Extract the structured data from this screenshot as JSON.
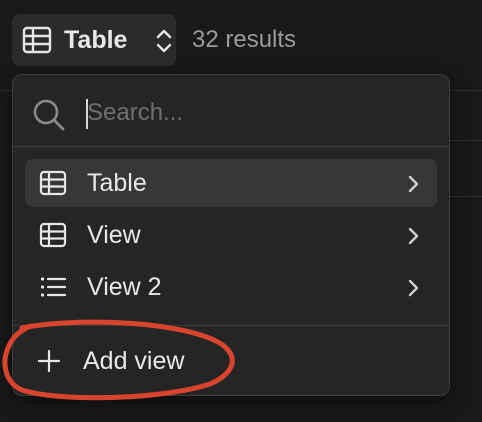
{
  "header": {
    "view_label": "Table",
    "view_icon": "table-icon",
    "chevron_icon": "chevron-up-down-icon",
    "results_text": "32 results"
  },
  "menu": {
    "search": {
      "placeholder": "Search...",
      "value": "",
      "icon": "search-icon"
    },
    "items": [
      {
        "label": "Table",
        "icon": "table-icon",
        "active": true
      },
      {
        "label": "View",
        "icon": "table-icon",
        "active": false
      },
      {
        "label": "View 2",
        "icon": "list-icon",
        "active": false
      }
    ],
    "add_view": {
      "label": "Add view",
      "icon": "plus-icon"
    }
  },
  "colors": {
    "background": "#191919",
    "menu_background": "#252525",
    "active_item": "#373737",
    "text": "#e8e8e8",
    "muted_text": "#9b9b9b",
    "annotation": "#d9442e"
  }
}
